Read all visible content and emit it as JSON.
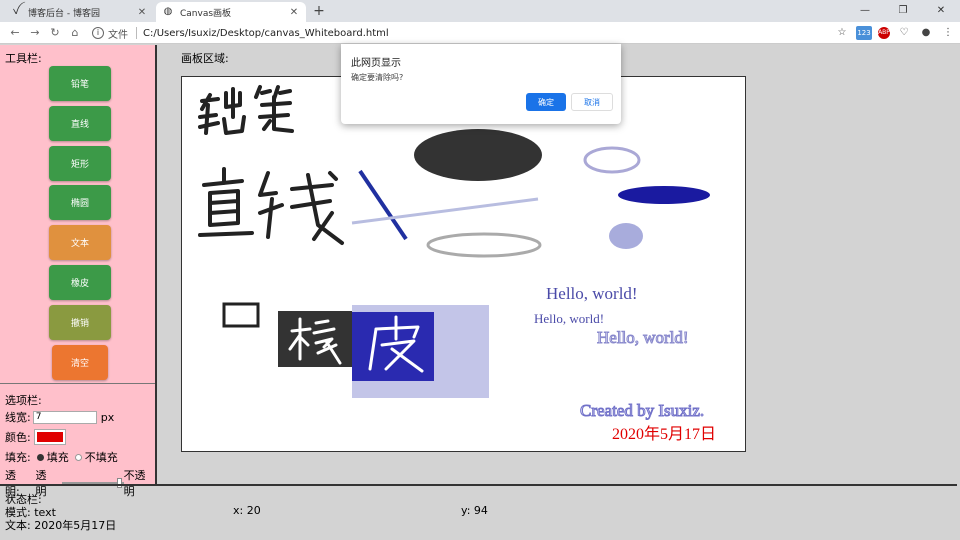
{
  "browser": {
    "tabs": [
      {
        "title": "博客后台 - 博客园",
        "icon": "blog-icon"
      },
      {
        "title": "Canvas画板",
        "icon": "globe-icon"
      }
    ],
    "new_tab_icon": "+",
    "url_label": "文件",
    "url": "C:/Users/Isuxiz/Desktop/canvas_Whiteboard.html",
    "ext_badge": "123",
    "ext_abp": "ABP"
  },
  "toolbar": {
    "title": "工具栏:",
    "buttons": [
      {
        "label": "铅笔",
        "color": "#3c9a48"
      },
      {
        "label": "直线",
        "color": "#3c9a48"
      },
      {
        "label": "矩形",
        "color": "#3c9a48"
      },
      {
        "label": "椭圆",
        "color": "#3c9a48"
      },
      {
        "label": "文本",
        "color": "#e0913e"
      },
      {
        "label": "橡皮",
        "color": "#3c9a48"
      },
      {
        "label": "撤销",
        "color": "#8a9a40"
      },
      {
        "label": "清空",
        "color": "#ec7630"
      }
    ]
  },
  "options": {
    "title": "选项栏:",
    "width_label": "线宽:",
    "width_value": "7",
    "width_unit": "px",
    "color_label": "颜色:",
    "color_value": "#e00000",
    "fill_label": "填充:",
    "fill_on": "填充",
    "fill_off": "不填充",
    "alpha_label": "透明:",
    "alpha_min": "透明",
    "alpha_max": "不透明",
    "alpha_level": 0.95
  },
  "board": {
    "label": "画板区域:",
    "text1": "Hello, world!",
    "text2": "Hello, world!",
    "text3": "Hello, world!",
    "credit": "Created by Isuxiz.",
    "date": "2020年5月17日"
  },
  "status": {
    "title": "状态栏:",
    "mode": "模式: text",
    "x": "x:  20",
    "y": "y:  94",
    "text": "文本: 2020年5月17日"
  },
  "dialog": {
    "title": "此网页显示",
    "message": "确定要清除吗?",
    "ok": "确定",
    "cancel": "取消"
  }
}
